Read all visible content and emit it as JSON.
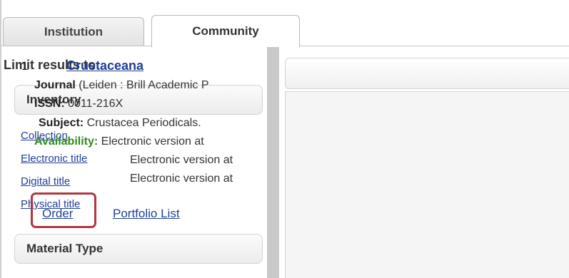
{
  "tabs": [
    {
      "label": "Institution",
      "active": false
    },
    {
      "label": "Community",
      "active": true
    }
  ],
  "facets": {
    "heading": "Limit results to:",
    "inventory": {
      "title": "Inventory",
      "links": [
        "Collection",
        "Electronic title",
        "Digital title",
        "Physical title"
      ]
    },
    "material_type": {
      "title": "Material Type"
    }
  },
  "result": {
    "number": "1",
    "title": "Crustaceana",
    "journal_label": "Journal",
    "journal_text": " (Leiden : Brill Academic P",
    "issn_label": "ISSN:",
    "issn_value": " 0011-216X",
    "subject_label": "Subject:",
    "subject_value": " Crustacea Periodicals.",
    "availability_label": "Availability:",
    "availability_lines": [
      "Electronic version at",
      "Electronic version at",
      "Electronic version at"
    ],
    "actions": {
      "order": "Order",
      "portfolio_list": "Portfolio List"
    }
  },
  "colors": {
    "link": "#1f3f99",
    "availability": "#2e8b1a",
    "highlight": "#b0383d"
  }
}
